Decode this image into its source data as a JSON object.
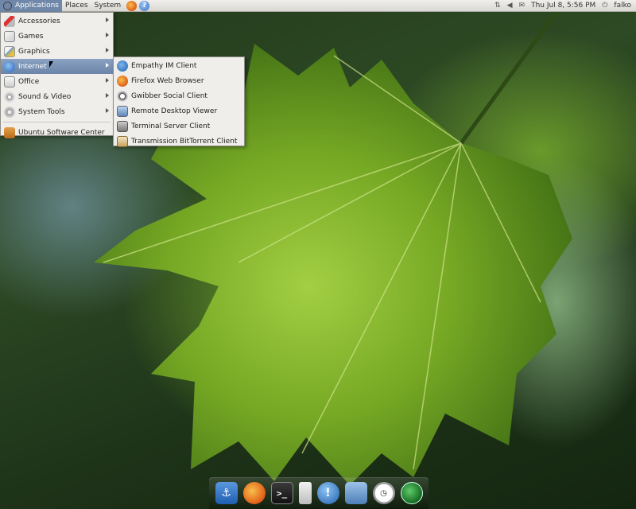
{
  "top_panel": {
    "menus": [
      "Applications",
      "Places",
      "System"
    ],
    "launchers": [
      "firefox-icon",
      "help-icon"
    ],
    "help_glyph": "?",
    "clock": "Thu Jul  8,  5:56 PM",
    "user": "falko",
    "tray_icons": [
      "network-icon",
      "volume-icon",
      "mail-icon",
      "power-icon"
    ]
  },
  "apps_menu": {
    "items": [
      {
        "label": "Accessories",
        "icon": "accessories-icon",
        "submenu": true
      },
      {
        "label": "Games",
        "icon": "games-icon",
        "submenu": true
      },
      {
        "label": "Graphics",
        "icon": "graphics-icon",
        "submenu": true
      },
      {
        "label": "Internet",
        "icon": "internet-icon",
        "submenu": true,
        "highlighted": true
      },
      {
        "label": "Office",
        "icon": "office-icon",
        "submenu": true
      },
      {
        "label": "Sound & Video",
        "icon": "sound-video-icon",
        "submenu": true
      },
      {
        "label": "System Tools",
        "icon": "system-tools-icon",
        "submenu": true
      }
    ],
    "footer_item": {
      "label": "Ubuntu Software Center",
      "icon": "software-center-icon"
    }
  },
  "internet_submenu": {
    "items": [
      {
        "label": "Empathy IM Client",
        "icon": "empathy-icon"
      },
      {
        "label": "Firefox Web Browser",
        "icon": "firefox-icon"
      },
      {
        "label": "Gwibber Social Client",
        "icon": "gwibber-icon"
      },
      {
        "label": "Remote Desktop Viewer",
        "icon": "remote-desktop-icon"
      },
      {
        "label": "Terminal Server Client",
        "icon": "terminal-server-icon"
      },
      {
        "label": "Transmission BitTorrent Client",
        "icon": "transmission-icon"
      }
    ]
  },
  "dock": {
    "icons": [
      "anchor-icon",
      "firefox-icon",
      "terminal-icon",
      "ipod-icon",
      "empathy-icon",
      "folder-icon",
      "clock-icon",
      "globe-icon"
    ],
    "terminal_glyph": ">_",
    "empathy_glyph": "!"
  },
  "colors": {
    "panel": "#e4e2dd",
    "menu_bg": "#efeeeb",
    "highlight": "#7890b2"
  }
}
